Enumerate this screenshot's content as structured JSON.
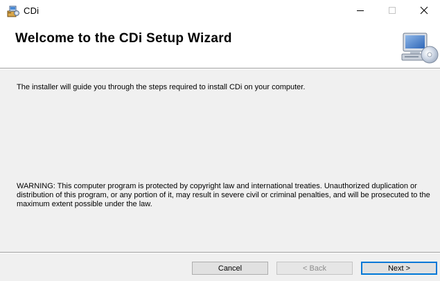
{
  "window": {
    "title": "CDi",
    "app_icon": "installer-icon",
    "controls": {
      "minimize_icon": "minimize-icon",
      "maximize_icon": "maximize-icon",
      "close_icon": "close-icon"
    }
  },
  "header": {
    "title": "Welcome to the CDi Setup Wizard",
    "graphic": "computer-cd-icon"
  },
  "body": {
    "intro": "The installer will guide you through the steps required to install CDi on your computer.",
    "warning": "WARNING: This computer program is protected by copyright law and international treaties. Unauthorized duplication or distribution of this program, or any portion of it, may result in severe civil or criminal penalties, and will be prosecuted to the maximum extent possible under the law."
  },
  "footer": {
    "cancel_label": "Cancel",
    "back_label": "< Back",
    "next_label": "Next >",
    "back_enabled": false
  },
  "colors": {
    "panel_background": "#f0f0f0",
    "button_face": "#e1e1e1",
    "default_button_border": "#0078d7",
    "disabled_text": "#8c8c8c"
  }
}
